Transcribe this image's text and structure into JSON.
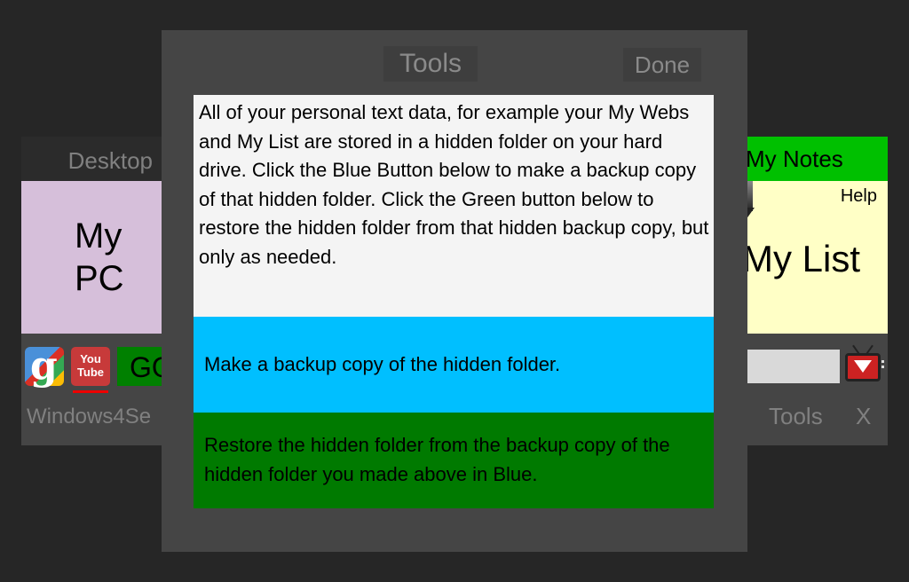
{
  "left_window": {
    "title": "Desktop",
    "tile_label": "My PC",
    "go_label": "GO",
    "youtube_label": "You Tube",
    "google_glyph": "g",
    "footer": "Windows4Se"
  },
  "right_window": {
    "title": "My Notes",
    "help_label": "Help",
    "tile_label": "My List",
    "search_value": "",
    "tools_label": "Tools",
    "close_label": "X"
  },
  "dialog": {
    "title": "Tools",
    "done_label": "Done",
    "info_text": "All of your personal text data, for example your My Webs and My List are stored in a hidden folder on your hard drive. Click the Blue Button below to make a backup copy of that hidden folder. Click the Green button below to restore the hidden folder from that hidden backup copy, but only as needed.",
    "backup_label": "Make a backup copy of the hidden folder.",
    "restore_label": "Restore the hidden folder from the backup copy of the hidden folder you made above in Blue."
  },
  "colors": {
    "backup_blue": "#00bfff",
    "restore_green": "#007a00",
    "my_pc_tile": "#d6bfda",
    "my_list_tile": "#ffffc6",
    "my_notes_header": "#00c000"
  }
}
